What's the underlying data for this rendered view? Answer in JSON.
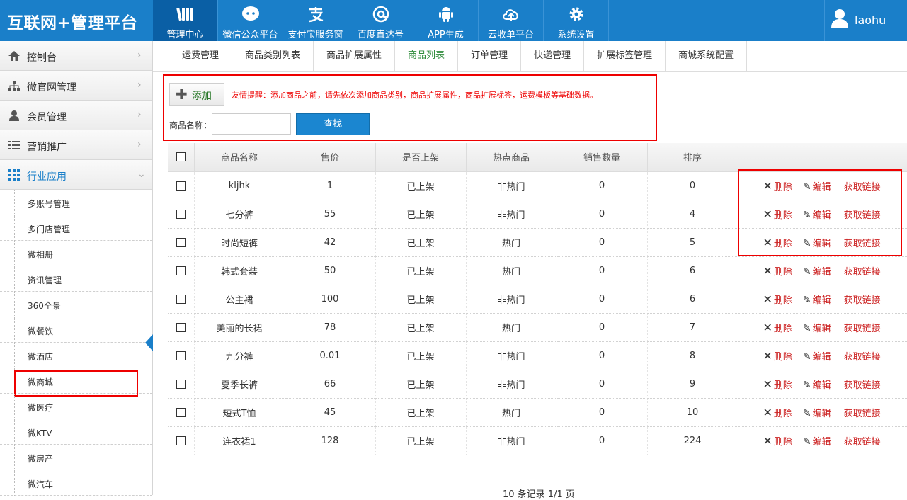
{
  "logo": "互联网+管理平台",
  "nav": [
    {
      "label": "管理中心",
      "icon": "books-icon",
      "active": true
    },
    {
      "label": "微信公众平台",
      "icon": "wechat-icon"
    },
    {
      "label": "支付宝服务窗",
      "icon": "alipay-icon"
    },
    {
      "label": "百度直达号",
      "icon": "baidu-icon"
    },
    {
      "label": "APP生成",
      "icon": "android-icon"
    },
    {
      "label": "云收单平台",
      "icon": "cloud-upload-icon"
    },
    {
      "label": "系统设置",
      "icon": "gear-icon"
    }
  ],
  "user": {
    "name": "laohu"
  },
  "sidebar": {
    "main": [
      {
        "label": "控制台",
        "icon": "home-icon"
      },
      {
        "label": "微官网管理",
        "icon": "sitemap-icon"
      },
      {
        "label": "会员管理",
        "icon": "user-icon"
      },
      {
        "label": "营销推广",
        "icon": "list-icon"
      },
      {
        "label": "行业应用",
        "icon": "grid-icon",
        "open": true
      }
    ],
    "sub": [
      "多账号管理",
      "多门店管理",
      "微相册",
      "资讯管理",
      "360全景",
      "微餐饮",
      "微酒店",
      "微商城",
      "微医疗",
      "微KTV",
      "微房产",
      "微汽车"
    ],
    "selected": "微商城"
  },
  "subtabs": [
    "运费管理",
    "商品类别列表",
    "商品扩展属性",
    "商品列表",
    "订单管理",
    "快递管理",
    "扩展标签管理",
    "商城系统配置"
  ],
  "active_subtab": "商品列表",
  "toolbar": {
    "add_label": "添加",
    "tip": "友情提醒：添加商品之前，请先依次添加商品类别，商品扩展属性，商品扩展标签，运费模板等基础数据。",
    "name_label": "商品名称：",
    "name_value": "",
    "search_label": "查找"
  },
  "table": {
    "headers": [
      "商品名称",
      "售价",
      "是否上架",
      "热点商品",
      "销售数量",
      "排序"
    ],
    "ops": {
      "delete": "删除",
      "edit": "编辑",
      "link": "获取链接"
    },
    "rows": [
      {
        "name": "kljhk",
        "price": "1",
        "status": "已上架",
        "hot": "非热门",
        "sold": "0",
        "sort": "0"
      },
      {
        "name": "七分裤",
        "price": "55",
        "status": "已上架",
        "hot": "非热门",
        "sold": "0",
        "sort": "4"
      },
      {
        "name": "时尚短裤",
        "price": "42",
        "status": "已上架",
        "hot": "热门",
        "sold": "0",
        "sort": "5"
      },
      {
        "name": "韩式套装",
        "price": "50",
        "status": "已上架",
        "hot": "热门",
        "sold": "0",
        "sort": "6"
      },
      {
        "name": "公主裙",
        "price": "100",
        "status": "已上架",
        "hot": "非热门",
        "sold": "0",
        "sort": "6"
      },
      {
        "name": "美丽的长裙",
        "price": "78",
        "status": "已上架",
        "hot": "热门",
        "sold": "0",
        "sort": "7"
      },
      {
        "name": "九分裤",
        "price": "0.01",
        "status": "已上架",
        "hot": "非热门",
        "sold": "0",
        "sort": "8"
      },
      {
        "name": "夏季长裤",
        "price": "66",
        "status": "已上架",
        "hot": "非热门",
        "sold": "0",
        "sort": "9"
      },
      {
        "name": "短式T恤",
        "price": "45",
        "status": "已上架",
        "hot": "热门",
        "sold": "0",
        "sort": "10"
      },
      {
        "name": "连衣裙1",
        "price": "128",
        "status": "已上架",
        "hot": "非热门",
        "sold": "0",
        "sort": "224"
      }
    ]
  },
  "pager": "10 条记录 1/1 页"
}
